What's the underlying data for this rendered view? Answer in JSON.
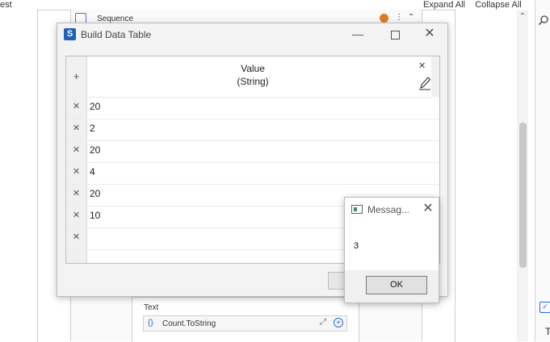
{
  "background": {
    "top_left_text": "est",
    "toolbar": {
      "expand_all": "Expand All",
      "collapse_all": "Collapse All"
    },
    "sequence": {
      "label": "Sequence"
    },
    "text_activity": {
      "label": "Text",
      "value": "Count.ToString",
      "braces_icon_text": "{}"
    },
    "right_panel": {
      "letter": "T"
    }
  },
  "dialog": {
    "title": "Build Data Table",
    "column": {
      "name": "Value",
      "type": "(String)"
    },
    "rows": [
      {
        "value": "20"
      },
      {
        "value": "2"
      },
      {
        "value": "20"
      },
      {
        "value": "4"
      },
      {
        "value": "20"
      },
      {
        "value": "10"
      },
      {
        "value": ""
      }
    ]
  },
  "message_box": {
    "title": "Messag...",
    "text": "3",
    "ok_label": "OK"
  },
  "colors": {
    "accent_blue": "#2060b8",
    "warning_orange": "#e07a1f"
  }
}
